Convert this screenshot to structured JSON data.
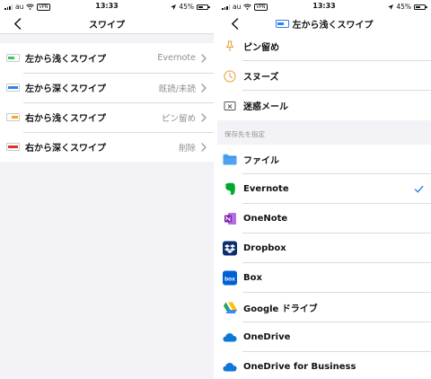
{
  "status_left": {
    "carrier": "au",
    "vpn": "VPN",
    "time": "13:33",
    "battery": "45%"
  },
  "status_right": {
    "carrier": "au",
    "vpn": "VPN",
    "time": "13:33",
    "battery": "45%"
  },
  "left_screen": {
    "title": "スワイプ",
    "rows": [
      {
        "label": "左から浅くスワイプ",
        "value": "Evernote",
        "color": "#34c759"
      },
      {
        "label": "左から深くスワイプ",
        "value": "既読/未読",
        "color": "#2f80ed"
      },
      {
        "label": "右から浅くスワイプ",
        "value": "ピン留め",
        "color": "#f5a623"
      },
      {
        "label": "右から深くスワイプ",
        "value": "削除",
        "color": "#e03131"
      }
    ]
  },
  "right_screen": {
    "title": "左から浅くスワイプ",
    "actions": [
      {
        "label": "ピン留め",
        "icon": "pin-icon"
      },
      {
        "label": "スヌーズ",
        "icon": "clock-icon"
      },
      {
        "label": "迷惑メール",
        "icon": "spam-icon"
      }
    ],
    "section_header": "保存先を指定",
    "destinations": [
      {
        "label": "ファイル",
        "icon": "files-folder-icon",
        "selected": false
      },
      {
        "label": "Evernote",
        "icon": "evernote-icon",
        "selected": true
      },
      {
        "label": "OneNote",
        "icon": "onenote-icon",
        "selected": false
      },
      {
        "label": "Dropbox",
        "icon": "dropbox-icon",
        "selected": false
      },
      {
        "label": "Box",
        "icon": "box-icon",
        "selected": false
      },
      {
        "label": "Google ドライブ",
        "icon": "google-drive-icon",
        "selected": false
      },
      {
        "label": "OneDrive",
        "icon": "onedrive-icon",
        "selected": false
      },
      {
        "label": "OneDrive for Business",
        "icon": "onedrive-business-icon",
        "selected": false
      }
    ]
  },
  "colors": {
    "accent": "#2f80ed",
    "secondary_text": "#8e8e93",
    "grouped_background": "#f2f2f7"
  }
}
